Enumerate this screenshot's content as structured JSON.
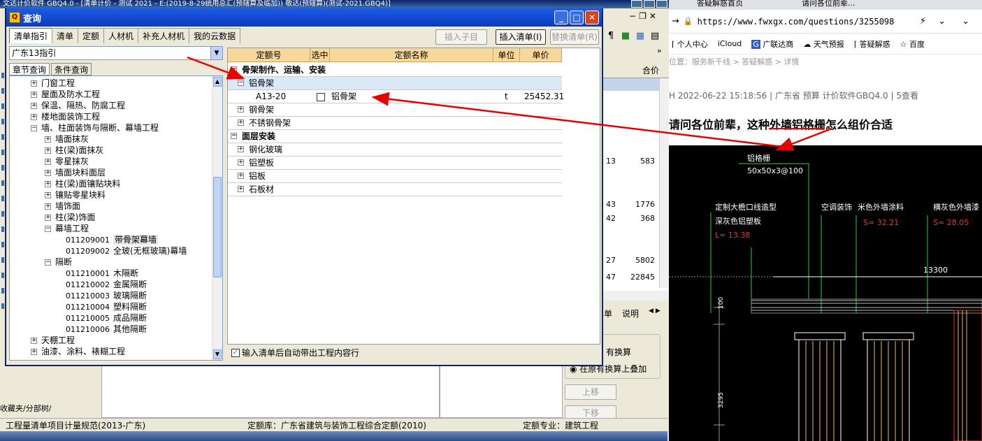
{
  "app": {
    "title": "文达计价软件 GBQ4.0  - [清单计价 - 测试 2021  - E:(2019-8-29统用总汇(预辖算及临加)) 敬达(预辖算)(测试-2021.GBQ4)]",
    "grid_header_total": "合价",
    "grid_values_a": [
      "13",
      "43",
      "42",
      "27",
      "47"
    ],
    "grid_values_b": [
      "583",
      "1776",
      "368",
      "5802",
      "22845"
    ],
    "lower_tab_1": "单",
    "lower_tab_2": "说明",
    "option_1": "有换算",
    "option_2": "在原有换算上叠加",
    "btn_up": "上移",
    "btn_down": "下移",
    "side_tabs": "收藏夹/分部树/",
    "status_1": "工程量清单项目计量规范(2013-广东)",
    "status_2": "定额库：广东省建筑与装饰工程综合定额(2010)",
    "status_3": "定额专业：建筑工程"
  },
  "dialog": {
    "title": "查询",
    "logo": "Q",
    "tabs": [
      "清单指引",
      "清单",
      "定额",
      "人材机",
      "补充人材机",
      "我的云数据"
    ],
    "btn_insert_child": "插入子目",
    "btn_insert_list": "插入清单(I)",
    "btn_replace_list": "替换清单(R)",
    "combo_value": "广东13指引",
    "subtabs": [
      "章节查询",
      "条件查询"
    ],
    "tree": [
      {
        "label": "门窗工程",
        "level": 1,
        "pm": "+"
      },
      {
        "label": "屋面及防水工程",
        "level": 1,
        "pm": "+"
      },
      {
        "label": "保温、隔热、防腐工程",
        "level": 1,
        "pm": "+"
      },
      {
        "label": "楼地面装饰工程",
        "level": 1,
        "pm": "+"
      },
      {
        "label": "墙、柱面装饰与隔断、幕墙工程",
        "level": 1,
        "pm": "−"
      },
      {
        "label": "墙面抹灰",
        "level": 2,
        "pm": "+"
      },
      {
        "label": "柱(梁)面抹灰",
        "level": 2,
        "pm": "+"
      },
      {
        "label": "零星抹灰",
        "level": 2,
        "pm": "+"
      },
      {
        "label": "墙面块料面层",
        "level": 2,
        "pm": "+"
      },
      {
        "label": "柱(梁)面镶贴块料",
        "level": 2,
        "pm": "+"
      },
      {
        "label": "镶贴零星块料",
        "level": 2,
        "pm": "+"
      },
      {
        "label": "墙饰面",
        "level": 2,
        "pm": "+"
      },
      {
        "label": "柱(梁)饰面",
        "level": 2,
        "pm": "+"
      },
      {
        "label": "幕墙工程",
        "level": 2,
        "pm": "−"
      },
      {
        "label": "带骨架幕墙",
        "code": "011209001",
        "level": 3,
        "hl": true
      },
      {
        "label": "全玻(无框玻璃)幕墙",
        "code": "011209002",
        "level": 3
      },
      {
        "label": "隔断",
        "level": 2,
        "pm": "−"
      },
      {
        "label": "木隔断",
        "code": "011210001",
        "level": 3
      },
      {
        "label": "金属隔断",
        "code": "011210002",
        "level": 3
      },
      {
        "label": "玻璃隔断",
        "code": "011210003",
        "level": 3
      },
      {
        "label": "塑料隔断",
        "code": "011210004",
        "level": 3
      },
      {
        "label": "成品隔断",
        "code": "011210005",
        "level": 3
      },
      {
        "label": "其他隔断",
        "code": "011210006",
        "level": 3
      },
      {
        "label": "天棚工程",
        "level": 1,
        "pm": "+"
      },
      {
        "label": "油漆、涂料、裱糊工程",
        "level": 1,
        "pm": "+"
      }
    ],
    "grid_headers": [
      "定额号",
      "选中",
      "定额名称",
      "单位",
      "单价"
    ],
    "grid_rows": [
      {
        "type": "group",
        "pm": "−",
        "name": "骨架制作、运输、安装"
      },
      {
        "type": "sub",
        "pm": "−",
        "name": "铝骨架",
        "selected": true
      },
      {
        "type": "item",
        "code": "A13-20",
        "name": "铝骨架",
        "unit": "t",
        "price": "25452.31"
      },
      {
        "type": "sub",
        "pm": "+",
        "name": "钢骨架"
      },
      {
        "type": "sub",
        "pm": "+",
        "name": "不锈钢骨架"
      },
      {
        "type": "group",
        "pm": "−",
        "name": "面层安装"
      },
      {
        "type": "sub",
        "pm": "+",
        "name": "钢化玻璃"
      },
      {
        "type": "sub",
        "pm": "+",
        "name": "铝塑板"
      },
      {
        "type": "sub",
        "pm": "+",
        "name": "铝板"
      },
      {
        "type": "sub",
        "pm": "+",
        "name": "石板材"
      }
    ],
    "auto_check_label": "输入清单后自动带出工程内容行"
  },
  "browser": {
    "tab_1": "答疑解惑首页",
    "tab_2": "请问各位前辈...",
    "url": "https://www.fwxgx.com/questions/3255098",
    "bookmarks": [
      "个人中心",
      "iCloud",
      "广联达商",
      "天气预报",
      "答疑解惑",
      "百度"
    ],
    "crumb": "位置：服务新干线 > 答疑解惑 > 详情",
    "meta": "H   2022-06-22 15:18:56   |   广东省  预算 计价软件GBQ4.0   |   5查看",
    "question": "请问各位前辈，这种外墙铝格栅怎么组价合适",
    "cad_labels": {
      "grille": "铝格栅",
      "grille_spec": "50x50x3@100",
      "eave": "定制大檐口线造型",
      "eave_color": "深灰色铝塑板",
      "eave_len": "L= 13.38",
      "ac": "空调装饰",
      "wall_paint": "米色外墙涂料",
      "wall_area": "S= 32.21",
      "wall2": "横灰色外墙漆",
      "wall2_area": "S= 28.05",
      "dim_13300": "13300",
      "dim_1": "100",
      "dim_2": "3295"
    }
  },
  "colors": {
    "arrow": "#e60000",
    "grid_header": "#f7d79a",
    "dialog_title": "#1d5ae3"
  }
}
